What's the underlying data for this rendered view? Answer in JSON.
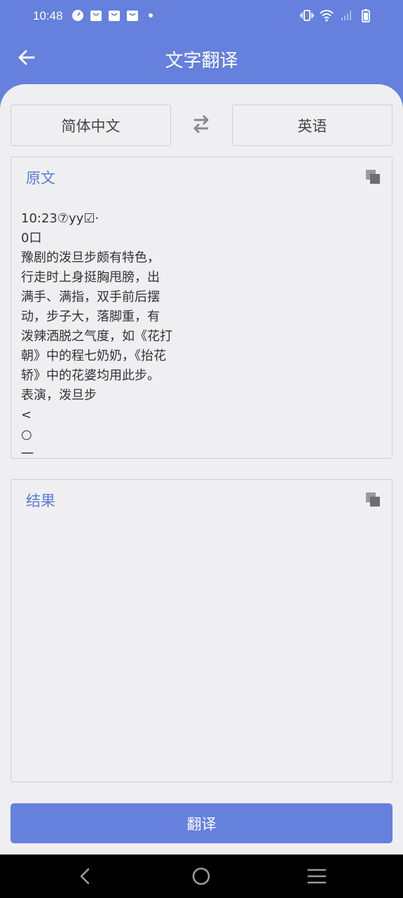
{
  "status_bar": {
    "time": "10:48",
    "left_icons": [
      "speedometer-icon",
      "bag-icon",
      "bag-icon",
      "bag-icon",
      "dot-icon"
    ],
    "right_icons": [
      "vibrate-icon",
      "wifi-icon",
      "signal-icon",
      "battery-icon"
    ]
  },
  "app_bar": {
    "title": "文字翻译",
    "back_icon": "back-arrow-icon"
  },
  "languages": {
    "source": "简体中文",
    "target": "英语",
    "swap_icon": "swap-icon"
  },
  "source_panel": {
    "title": "原文",
    "text": "10:23⑦yy☑·\n0口\n豫剧的泼旦步颇有特色，\n行走时上身挺胸甩膀，出\n满手、满指，双手前后摆\n动，步子大，落脚重，有\n泼辣洒脱之气度，如《花打\n朝》中的程七奶奶，《抬花\n轿》中的花婆均用此步。\n表演，泼旦步\n<\n○\n一"
  },
  "result_panel": {
    "title": "结果",
    "text": ""
  },
  "translate_button": "翻译",
  "colors": {
    "primary": "#6580dd",
    "panel_title": "#5b7bd6",
    "background": "#efeff2"
  },
  "nav_bar": {
    "icons": [
      "nav-back-icon",
      "nav-home-icon",
      "nav-menu-icon"
    ]
  }
}
